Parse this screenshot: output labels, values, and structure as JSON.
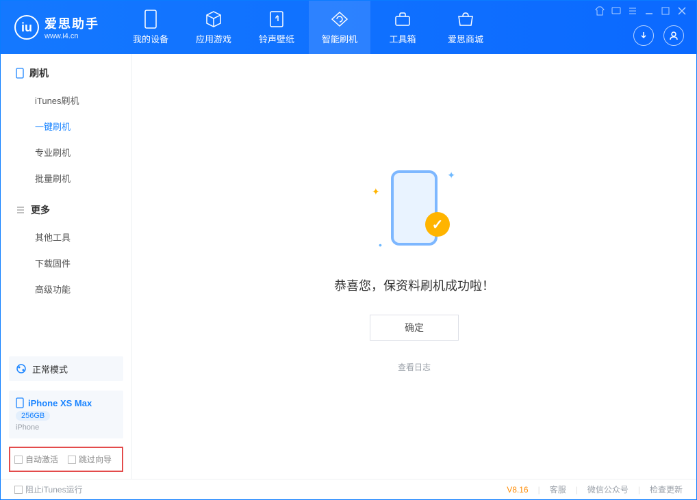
{
  "app": {
    "logo_title": "爱思助手",
    "logo_url": "www.i4.cn"
  },
  "nav": [
    {
      "label": "我的设备",
      "icon": "phone-icon"
    },
    {
      "label": "应用游戏",
      "icon": "cube-icon"
    },
    {
      "label": "铃声壁纸",
      "icon": "music-icon"
    },
    {
      "label": "智能刷机",
      "icon": "refresh-icon",
      "active": true
    },
    {
      "label": "工具箱",
      "icon": "toolbox-icon"
    },
    {
      "label": "爱思商城",
      "icon": "store-icon"
    }
  ],
  "sidebar": {
    "section1_title": "刷机",
    "items1": [
      {
        "label": "iTunes刷机"
      },
      {
        "label": "一键刷机",
        "active": true
      },
      {
        "label": "专业刷机"
      },
      {
        "label": "批量刷机"
      }
    ],
    "section2_title": "更多",
    "items2": [
      {
        "label": "其他工具"
      },
      {
        "label": "下载固件"
      },
      {
        "label": "高级功能"
      }
    ]
  },
  "status": {
    "mode": "正常模式"
  },
  "device": {
    "name": "iPhone XS Max",
    "storage": "256GB",
    "type": "iPhone"
  },
  "checkboxes": {
    "auto_activate": "自动激活",
    "skip_guide": "跳过向导"
  },
  "main": {
    "success_text": "恭喜您，保资料刷机成功啦！",
    "confirm": "确定",
    "view_log": "查看日志"
  },
  "footer": {
    "block_itunes": "阻止iTunes运行",
    "version": "V8.16",
    "support": "客服",
    "wechat": "微信公众号",
    "check_update": "检查更新"
  }
}
